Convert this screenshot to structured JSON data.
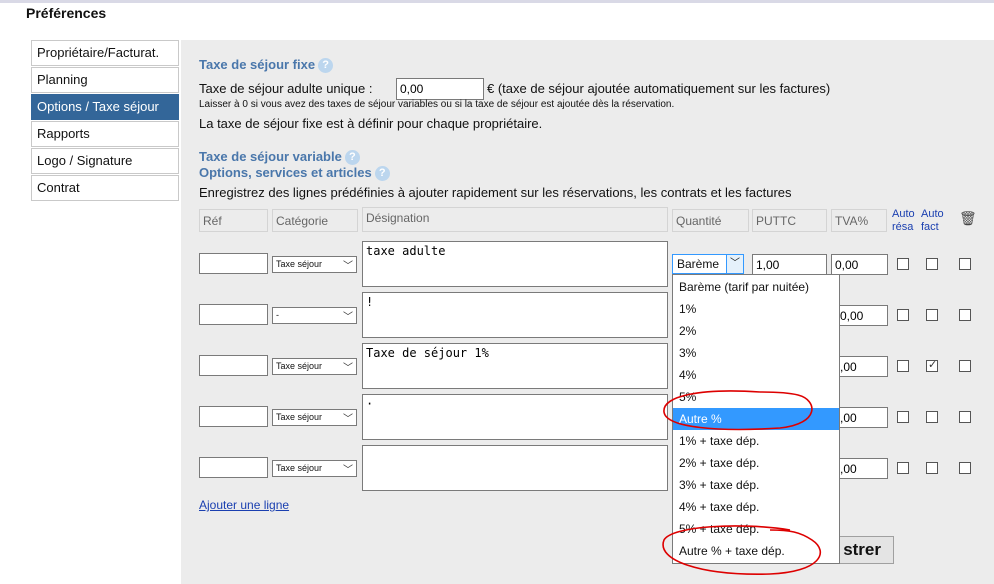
{
  "page_title": "Préférences",
  "sidebar": {
    "items": [
      {
        "label": "Propriétaire/Facturat.",
        "active": false
      },
      {
        "label": "Planning",
        "active": false
      },
      {
        "label": "Options / Taxe séjour",
        "active": true
      },
      {
        "label": "Rapports",
        "active": false
      },
      {
        "label": "Logo / Signature",
        "active": false
      },
      {
        "label": "Contrat",
        "active": false
      }
    ]
  },
  "fixed_tax": {
    "title": "Taxe de séjour fixe",
    "adult_label": "Taxe de séjour adulte unique :",
    "adult_value": "0,00",
    "adult_suffix": "€ (taxe de séjour ajoutée automatiquement sur les factures)",
    "note_small": "Laisser à 0 si vous avez des taxes de séjour variables ou si la taxe de séjour est ajoutée dès la réservation.",
    "note": "La taxe de séjour fixe est à définir pour chaque propriétaire."
  },
  "variable_tax": {
    "title": "Taxe de séjour variable",
    "options_title": "Options, services et articles",
    "description": "Enregistrez des lignes prédéfinies à ajouter rapidement sur les réservations, les contrats et les factures"
  },
  "table": {
    "headers": {
      "ref": "Réf",
      "category": "Catégorie",
      "designation": "Désignation",
      "quantity": "Quantité",
      "puttc": "PUTTC",
      "tva": "TVA%",
      "auto_resa_1": "Auto",
      "auto_resa_2": "résa",
      "auto_fact_1": "Auto",
      "auto_fact_2": "fact"
    },
    "rows": [
      {
        "ref": "",
        "category": "Taxe séjour",
        "designation": "taxe adulte",
        "puttc": "1,00",
        "tva": "0,00",
        "auto_resa": false,
        "auto_fact": false,
        "delete": false
      },
      {
        "ref": "",
        "category": "-",
        "designation": "!",
        "puttc": "",
        "tva": "0,00",
        "auto_resa": false,
        "auto_fact": false,
        "delete": false
      },
      {
        "ref": "",
        "category": "Taxe séjour",
        "designation": "Taxe de séjour 1%",
        "puttc": "",
        "tva": ",00",
        "auto_resa": false,
        "auto_fact": true,
        "delete": false
      },
      {
        "ref": "",
        "category": "Taxe séjour",
        "designation": "·",
        "puttc": "",
        "tva": ",00",
        "auto_resa": false,
        "auto_fact": false,
        "delete": false
      },
      {
        "ref": "",
        "category": "Taxe séjour",
        "designation": "",
        "puttc": "",
        "tva": ",00",
        "auto_resa": false,
        "auto_fact": false,
        "delete": false
      }
    ],
    "add_line": "Ajouter une ligne"
  },
  "quantity_dropdown": {
    "selected": "Barème",
    "options": [
      "Barème (tarif par nuitée)",
      "1%",
      "2%",
      "3%",
      "4%",
      "5%",
      "Autre %",
      "1% + taxe dép.",
      "2% + taxe dép.",
      "3% + taxe dép.",
      "4% + taxe dép.",
      "5% + taxe dép.",
      "Autre % + taxe dép."
    ],
    "highlighted": "Autre %"
  },
  "save_button": "Enregistrer",
  "save_button_visible": "strer",
  "icons": {
    "help": "help-icon",
    "trash": "trash-icon",
    "chevron": "chevron-down-icon"
  },
  "colors": {
    "accent": "#336699",
    "section_title": "#4a77ab",
    "selection": "#3399ff",
    "annotation": "#dd0000"
  }
}
